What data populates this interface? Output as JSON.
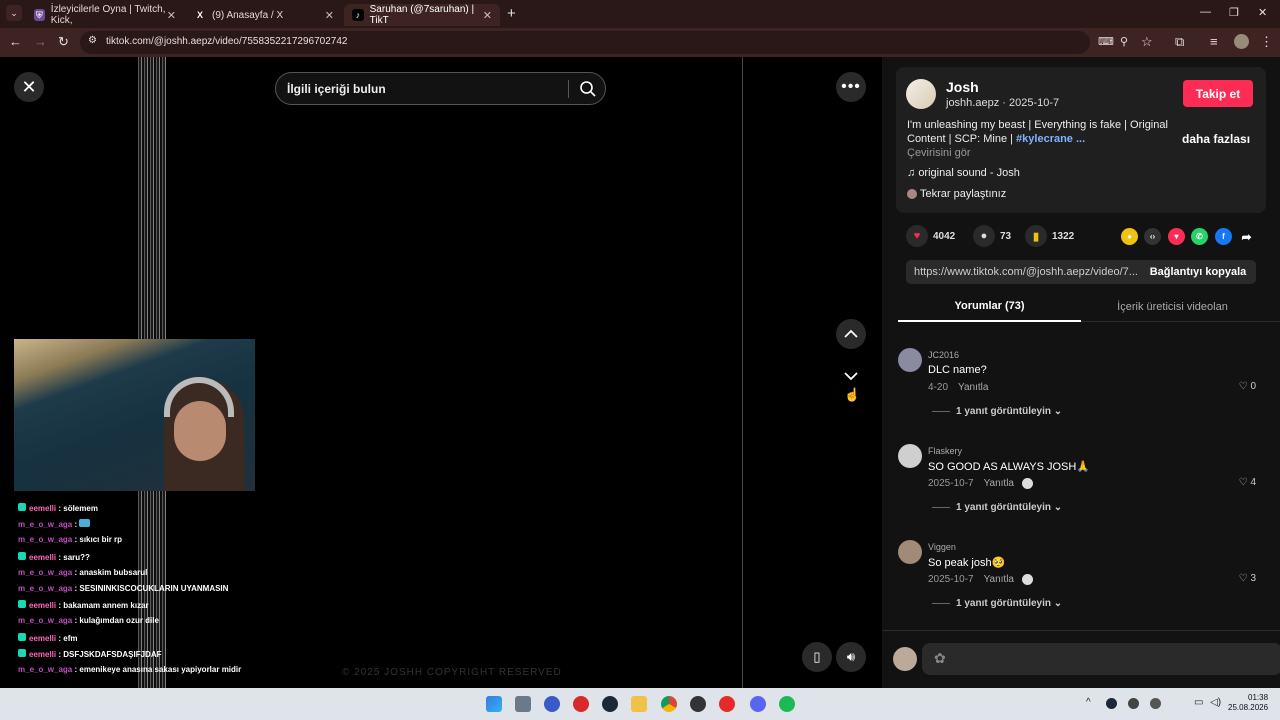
{
  "browser": {
    "tabs": [
      {
        "label": "İzleyicilerle Oyna | Twitch, Kick,",
        "favicon": "shield"
      },
      {
        "label": "(9) Anasayfa / X",
        "favicon": "X"
      },
      {
        "label": "Saruhan (@7saruhan) | TikT",
        "favicon": "tiktok"
      }
    ],
    "new_tab": "+",
    "url": "tiktok.com/@joshh.aepz/video/7558352217296702742"
  },
  "video": {
    "search_placeholder": "İlgili içeriği bulun",
    "copyright": "© 2025 JOSHH COPYRIGHT RESERVED"
  },
  "chat": [
    {
      "user": "eemelli",
      "message": "sölemem",
      "badge": true
    },
    {
      "user": "m_e_o_w_aga",
      "message": "",
      "badge": false
    },
    {
      "user": "m_e_o_w_aga",
      "message": "sıkıcı bir rp",
      "badge": false
    },
    {
      "user": "eemelli",
      "message": "saru??",
      "badge": true
    },
    {
      "user": "m_e_o_w_aga",
      "message": "anaskim bubsarul",
      "badge": false
    },
    {
      "user": "m_e_o_w_aga",
      "message": "SESININKISCOCUKLARIN UYANMASIN",
      "badge": false
    },
    {
      "user": "eemelli",
      "message": "bakamam annem kızar",
      "badge": true
    },
    {
      "user": "m_e_o_w_aga",
      "message": "kulağımdan ozur dile",
      "badge": false
    },
    {
      "user": "eemelli",
      "message": "efm",
      "badge": true
    },
    {
      "user": "eemelli",
      "message": "DSFJSKDAFSDAŞIFJDAF",
      "badge": true
    },
    {
      "user": "m_e_o_w_aga",
      "message": "emenikeye anasına sakası yapiyorlar midir",
      "badge": false
    }
  ],
  "author": {
    "name": "Josh",
    "handle": "joshh.aepz · 2025-10-7",
    "follow_label": "Takip et",
    "description": "I'm unleashing my beast | Everything is fake | Original Content | SCP: Mine | ",
    "hashtag": "#kylecrane ...",
    "translate": "Çevirisini gör",
    "more": "daha fazlası",
    "music": "original sound - Josh",
    "repost": "Tekrar paylaştınız"
  },
  "stats": {
    "likes": "4042",
    "comments": "73",
    "saves": "1322"
  },
  "link": {
    "url": "https://www.tiktok.com/@joshh.aepz/video/7...",
    "copy_label": "Bağlantıyı kopyala"
  },
  "tabs": {
    "comments": "Yorumlar (73)",
    "creator": "İçerik üreticisi videolan"
  },
  "comments": [
    {
      "user": "JC2016",
      "text": "DLC name?",
      "date": "4-20",
      "reply": "Yanıtla",
      "likes": "0",
      "thread": "1 yanıt görüntüleyin"
    },
    {
      "user": "Flaskery",
      "text": "SO GOOD AS ALWAYS JOSH🙏",
      "date": "2025-10-7",
      "reply": "Yanıtla",
      "likes": "4",
      "thread": "1 yanıt görüntüleyin"
    },
    {
      "user": "Viggen",
      "text": "So peak josh🥺",
      "date": "2025-10-7",
      "reply": "Yanıtla",
      "likes": "3",
      "thread": "1 yanıt görüntüleyin"
    }
  ],
  "taskbar": {
    "time": "01:38",
    "date": "25.08.2026"
  }
}
